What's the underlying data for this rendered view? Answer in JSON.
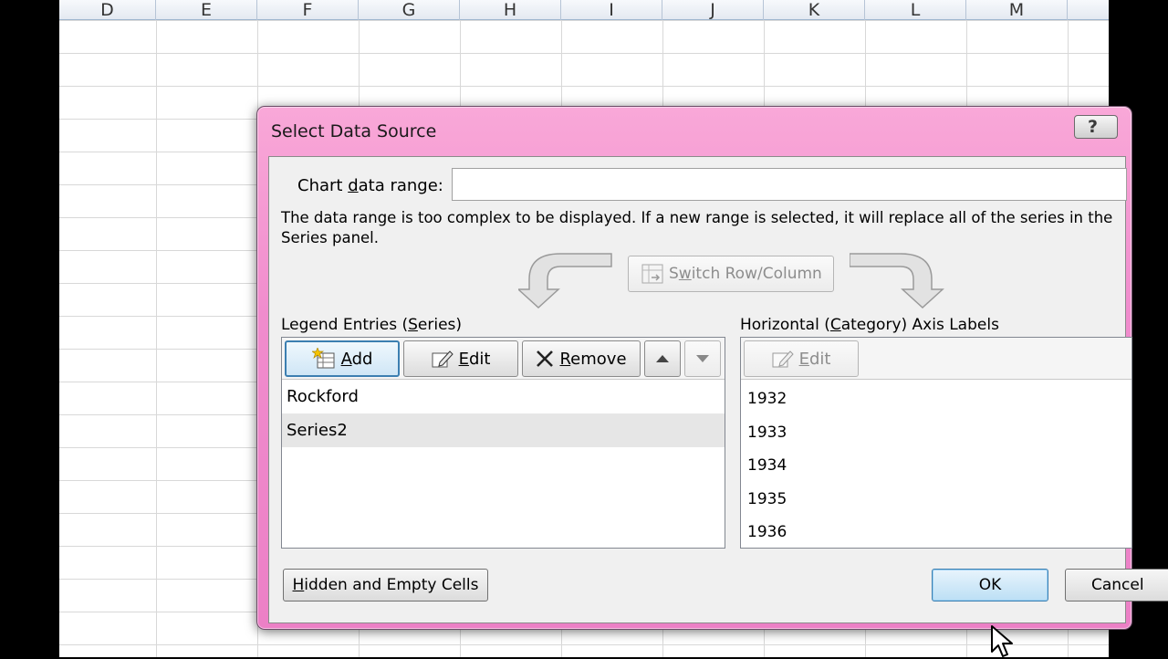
{
  "spreadsheet": {
    "columns": [
      "D",
      "E",
      "F",
      "G",
      "H",
      "I",
      "J",
      "K",
      "L",
      "M"
    ]
  },
  "dialog": {
    "title": "Select Data Source",
    "help_label": "?",
    "chart_data_range": {
      "label_pre": "Chart ",
      "label_ul": "d",
      "label_post": "ata range:",
      "value": ""
    },
    "note": "The data range is too complex to be displayed. If a new range is selected, it will replace all of the series in the Series panel.",
    "switch_button": {
      "label_pre": "S",
      "label_ul": "w",
      "label_post": "itch Row/Column"
    },
    "legend": {
      "label_pre": "Legend Entries (",
      "label_ul": "S",
      "label_post": "eries)",
      "add_ul": "A",
      "add_post": "dd",
      "edit_ul": "E",
      "edit_post": "dit",
      "remove_ul": "R",
      "remove_post": "emove",
      "items": [
        "Rockford",
        "Series2"
      ]
    },
    "axis": {
      "label_pre": "Horizontal (",
      "label_ul": "C",
      "label_post": "ategory) Axis Labels",
      "edit_ul": "E",
      "edit_post": "dit",
      "items": [
        "1932",
        "1933",
        "1934",
        "1935",
        "1936"
      ]
    },
    "hidden_button": {
      "label_ul": "H",
      "label_post": "idden and Empty Cells"
    },
    "ok_label": "OK",
    "cancel_label": "Cancel"
  },
  "colors": {
    "title_bar": "#f08ccd",
    "focus_border": "#3c7fb1",
    "selected_row": "#e6e6e6"
  }
}
